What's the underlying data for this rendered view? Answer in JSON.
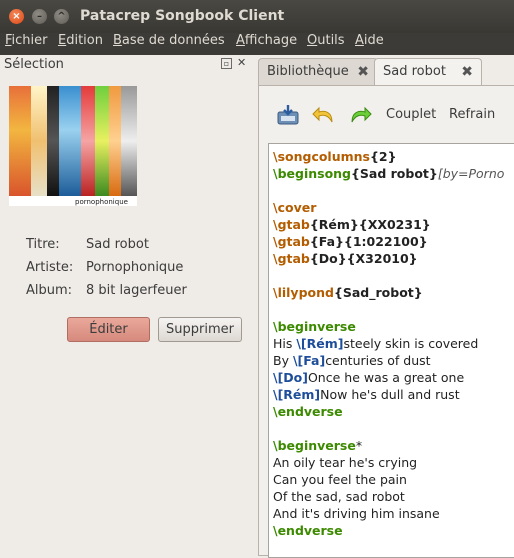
{
  "window": {
    "title": "Patacrep Songbook Client"
  },
  "menu": [
    {
      "pre": "",
      "u": "F",
      "post": "ichier"
    },
    {
      "pre": "",
      "u": "E",
      "post": "dition"
    },
    {
      "pre": "",
      "u": "B",
      "post": "ase de données"
    },
    {
      "pre": "",
      "u": "A",
      "post": "ffichage"
    },
    {
      "pre": "",
      "u": "O",
      "post": "utils"
    },
    {
      "pre": "",
      "u": "A",
      "post": "ide"
    }
  ],
  "selection": {
    "title": "Sélection",
    "cover_caption": "pornophonique",
    "fields": [
      {
        "label": "Titre:",
        "value": "Sad robot"
      },
      {
        "label": "Artiste:",
        "value": "Pornophonique"
      },
      {
        "label": "Album:",
        "value": "8 bit lagerfeuer"
      }
    ],
    "edit_label": "Éditer",
    "delete_label": "Supprimer"
  },
  "tabs": [
    {
      "label": "Bibliothèque"
    },
    {
      "label": "Sad robot"
    }
  ],
  "toolbar": {
    "verse_label": "Couplet",
    "chorus_label": "Refrain"
  },
  "editor_lines": [
    [
      {
        "t": "\\songcolumns",
        "c": "cmd2"
      },
      {
        "t": "{2}",
        "c": "arg"
      }
    ],
    [
      {
        "t": "\\beginsong",
        "c": "cmd"
      },
      {
        "t": "{Sad robot}",
        "c": "arg"
      },
      {
        "t": "[by=Porno",
        "c": "opt"
      }
    ],
    [],
    [
      {
        "t": "\\cover",
        "c": "cmd2"
      }
    ],
    [
      {
        "t": "\\gtab",
        "c": "cmd2"
      },
      {
        "t": "{Rém}{XX0231}",
        "c": "arg"
      }
    ],
    [
      {
        "t": "\\gtab",
        "c": "cmd2"
      },
      {
        "t": "{Fa}{1:022100}",
        "c": "arg"
      }
    ],
    [
      {
        "t": "\\gtab",
        "c": "cmd2"
      },
      {
        "t": "{Do}{X32010}",
        "c": "arg"
      }
    ],
    [],
    [
      {
        "t": "\\lilypond",
        "c": "cmd2"
      },
      {
        "t": "{Sad_robot}",
        "c": "arg"
      }
    ],
    [],
    [
      {
        "t": "\\beginverse",
        "c": "cmd"
      }
    ],
    [
      {
        "t": "His ",
        "c": ""
      },
      {
        "t": "\\[Rém]",
        "c": "chord"
      },
      {
        "t": "steely skin is covered",
        "c": ""
      }
    ],
    [
      {
        "t": "By ",
        "c": ""
      },
      {
        "t": "\\[Fa]",
        "c": "chord"
      },
      {
        "t": "centuries of dust",
        "c": ""
      }
    ],
    [
      {
        "t": "\\[Do]",
        "c": "chord"
      },
      {
        "t": "Once he was a great one",
        "c": ""
      }
    ],
    [
      {
        "t": "\\[Rém]",
        "c": "chord"
      },
      {
        "t": "Now he's dull and rust",
        "c": ""
      }
    ],
    [
      {
        "t": "\\endverse",
        "c": "cmd"
      }
    ],
    [],
    [
      {
        "t": "\\beginverse",
        "c": "cmd"
      },
      {
        "t": "*",
        "c": ""
      }
    ],
    [
      {
        "t": "An oily tear he's crying",
        "c": ""
      }
    ],
    [
      {
        "t": "Can you feel the pain",
        "c": ""
      }
    ],
    [
      {
        "t": "Of the sad, sad robot",
        "c": ""
      }
    ],
    [
      {
        "t": "And it's driving him insane",
        "c": ""
      }
    ],
    [
      {
        "t": "\\endverse",
        "c": "cmd"
      }
    ]
  ]
}
